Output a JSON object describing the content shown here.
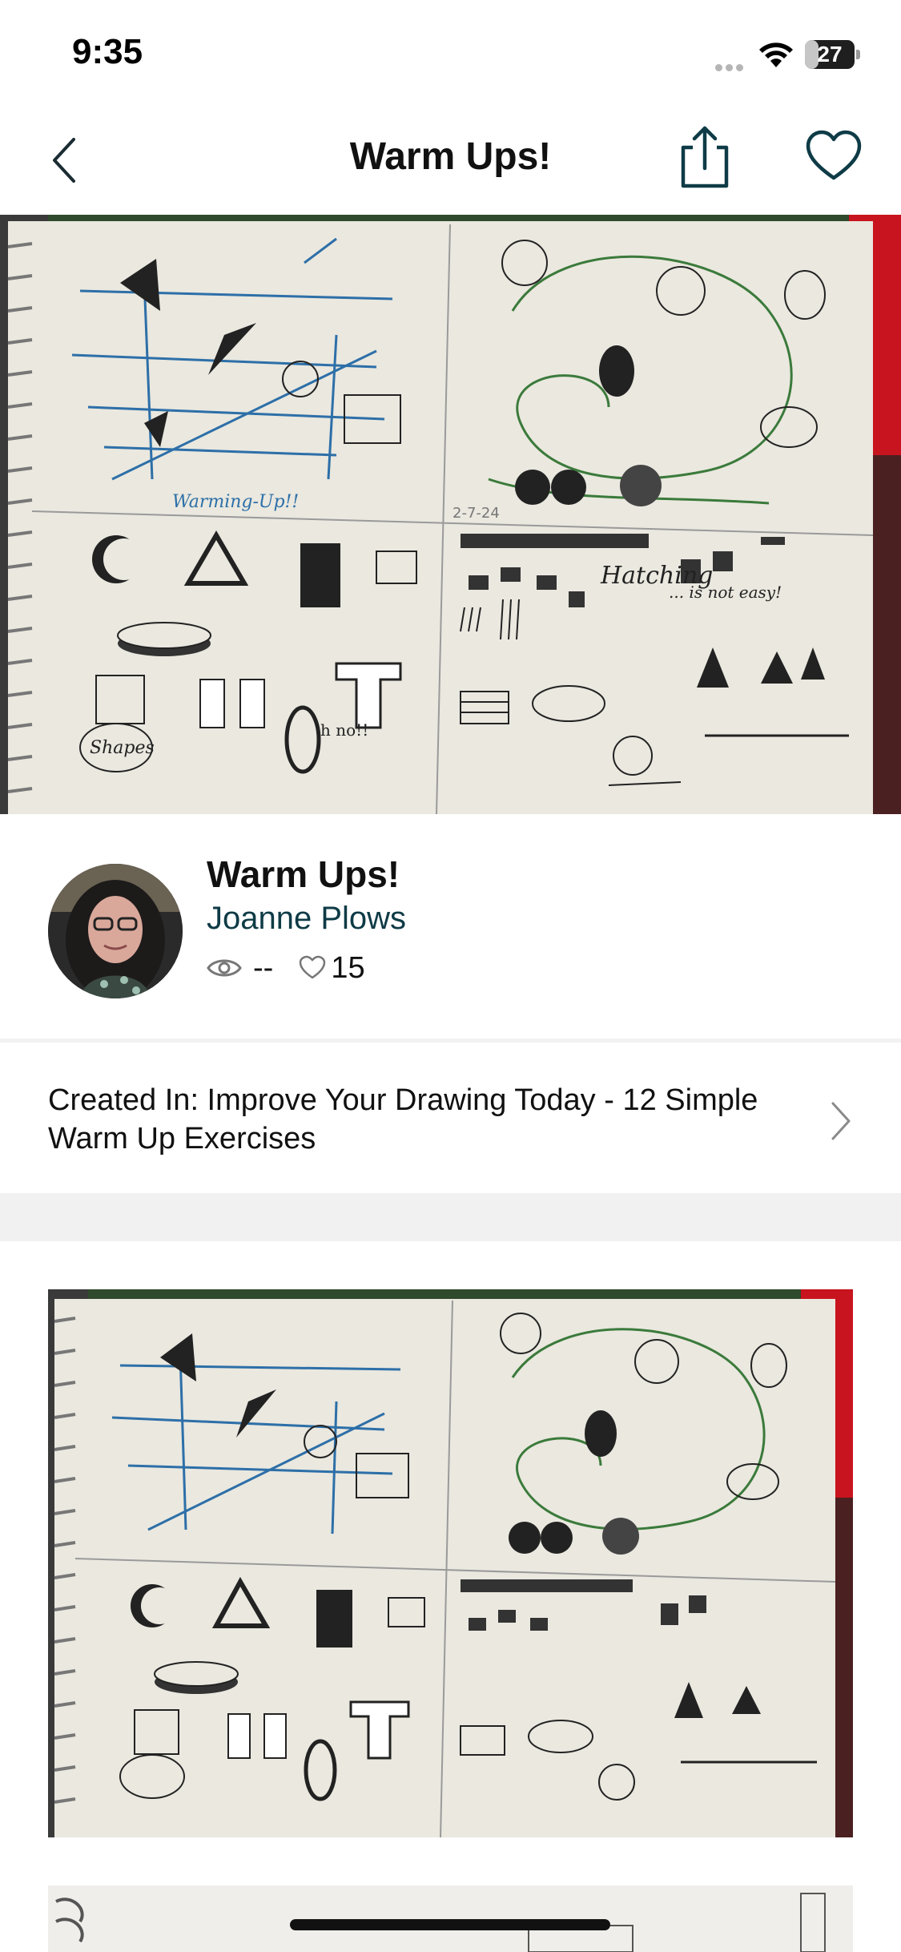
{
  "status_bar": {
    "time": "9:35",
    "battery": "27",
    "battery_level": 0.27
  },
  "nav": {
    "title": "Warm Ups!",
    "back_icon": "chevron-left-icon",
    "share_icon": "share-icon",
    "favorite_icon": "heart-icon"
  },
  "project": {
    "title": "Warm Ups!",
    "author": "Joanne Plows",
    "views": "--",
    "likes": "15"
  },
  "created_in": {
    "text": "Created In: Improve Your Drawing Today - 12 Simple Warm Up Exercises"
  },
  "sketch": {
    "warming_up": "Warming-Up!!",
    "date": "2-7-24",
    "hatching": "Hatching",
    "not_easy": "... is not easy!",
    "shapes": "Shapes",
    "oh_no": "h no!!"
  },
  "colors": {
    "author_link": "#0e3b46",
    "accent_red": "#c8141e",
    "accent_green": "#2f5a2b"
  }
}
